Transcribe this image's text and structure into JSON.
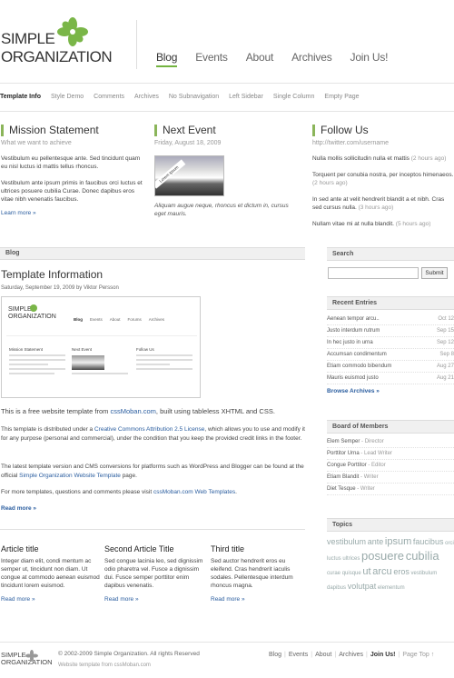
{
  "logo": {
    "line1": "SIMPLE",
    "line2": "ORGANIZATION"
  },
  "main_nav": [
    {
      "label": "Blog",
      "active": true
    },
    {
      "label": "Events",
      "active": false
    },
    {
      "label": "About",
      "active": false
    },
    {
      "label": "Archives",
      "active": false
    },
    {
      "label": "Join Us!",
      "active": false
    }
  ],
  "sub_nav": [
    "Template Info",
    "Style Demo",
    "Comments",
    "Archives",
    "No Subnavigation",
    "Left Sidebar",
    "Single Column",
    "Empty Page"
  ],
  "mission": {
    "title": "Mission Statement",
    "subtitle": "What we want to achieve",
    "p1": "Vestibulum eu pellentesque ante. Sed tincidunt quam eu nisl luctus id mattis tellus rhoncus.",
    "p2": "Vestibulum ante ipsum primis in faucibus orci luctus et ultrices posuere cubilia Curae. Donec dapibus eros vitae nibh venenatis faucibus.",
    "more": "Learn more »"
  },
  "event": {
    "title": "Next Event",
    "date": "Friday, August 18, 2009",
    "image_tag": "Lorem ipsum",
    "caption": "Aliquam augue neque, rhoncus et dictum in, cursus eget mauris."
  },
  "follow": {
    "title": "Follow Us",
    "subtitle": "http://twitter.com/username",
    "tweets": [
      {
        "text": "Nulla mollis sollicitudin nulla et mattis",
        "time": "(2 hours ago)"
      },
      {
        "text": "Torquent per conubia nostra, per inceptos himenaeos.",
        "time": "(2 hours ago)"
      },
      {
        "text": "In sed ante at velit hendrerit blandit a et nibh. Cras sed cursus nulla.",
        "time": "(3 hours ago)"
      },
      {
        "text": "Nullam vitae mi at nulla blandit.",
        "time": "(5 hours ago)"
      }
    ]
  },
  "blog": {
    "bar_label": "Blog",
    "post_title": "Template Information",
    "post_meta": "Saturday, September 19, 2009 by Viktor Persson",
    "shot": {
      "line1": "SIMPLE",
      "line2": "ORGANIZATION",
      "nav": [
        "Blog",
        "Events",
        "About",
        "Forums",
        "Archives"
      ],
      "cols": [
        "Mission Statement",
        "Next Event",
        "Follow Us"
      ]
    },
    "p1_a": "This is a free website template from ",
    "p1_link": "cssMoban.com",
    "p1_b": ", built using tableless XHTML and CSS.",
    "p2_a": "This template is distributed under a ",
    "p2_link": "Creative Commons Attribution 2.5 License",
    "p2_b": ", which allows you to use and modify it for any purpose (personal and commercial), under the condition that you keep the provided credit links in the footer.",
    "p3_a": "The latest template version and CMS conversions for platforms such as WordPress and Blogger can be found at the official ",
    "p3_link": "Simple Organization Website Template",
    "p3_b": " page.",
    "p4_a": "For more templates, questions and comments please visit ",
    "p4_link": "cssMoban.com Web Templates",
    "p4_b": ".",
    "more": "Read more »"
  },
  "articles": [
    {
      "title": "Article title",
      "text": "Integer diam elit, condi mentum ac semper ut, tincidunt non diam. Ut congue at commodo aenean euismod tincidunt lorem euismod.",
      "more": "Read more »"
    },
    {
      "title": "Second Article Title",
      "text": "Sed congue lacinia leo, sed dignissim odio pharetra vel. Fusce a dignissim dui. Fusce semper porttitor enim dapibus venenatis.",
      "more": "Read more »"
    },
    {
      "title": "Third title",
      "text": "Sed auctor hendrerit eros eu eleifend. Cras hendrerit iaculis sodales. Pellentesque interdum rhoncus magna.",
      "more": "Read more »"
    }
  ],
  "sidebar": {
    "search_title": "Search",
    "search_value": "",
    "search_button": "Submit",
    "recent_title": "Recent Entries",
    "recent": [
      {
        "title": "Aenean tempor arcu..",
        "date": "Oct 12"
      },
      {
        "title": "Justo interdum rutrum",
        "date": "Sep 15"
      },
      {
        "title": "In hec justo in urna",
        "date": "Sep 12"
      },
      {
        "title": "Accumsan condimentum",
        "date": "Sep 8"
      },
      {
        "title": "Etiam commodo bibendum",
        "date": "Aug 27"
      },
      {
        "title": "Mauris euismod justo",
        "date": "Aug 21"
      }
    ],
    "browse": "Browse Archives »",
    "board_title": "Board of Members",
    "members": [
      {
        "name": "Elem Semper",
        "role": " - Director"
      },
      {
        "name": "Porttitor Urna",
        "role": " - Lead Writer"
      },
      {
        "name": "Congue Porttitor",
        "role": " - Editor"
      },
      {
        "name": "Etiam Blandit",
        "role": " - Writer"
      },
      {
        "name": "Diet Tesque",
        "role": " - Writer"
      }
    ],
    "topics_title": "Topics",
    "topics": [
      {
        "word": "vestibulum",
        "size": 1
      },
      {
        "word": "ante",
        "size": 1
      },
      {
        "word": "ipsum",
        "size": 2
      },
      {
        "word": "faucibus",
        "size": 1
      },
      {
        "word": "orci",
        "size": 0
      },
      {
        "word": "luctus",
        "size": 0
      },
      {
        "word": "ultrices",
        "size": 0
      },
      {
        "word": "posuere",
        "size": 3
      },
      {
        "word": "cubilia",
        "size": 3
      },
      {
        "word": "curae",
        "size": 0
      },
      {
        "word": "quisque",
        "size": 0
      },
      {
        "word": "ut",
        "size": 2
      },
      {
        "word": "arcu",
        "size": 2
      },
      {
        "word": "eros",
        "size": 1
      },
      {
        "word": "vestibulum",
        "size": 0
      },
      {
        "word": "dapibus",
        "size": 0
      },
      {
        "word": "volutpat",
        "size": 1
      },
      {
        "word": "elementum",
        "size": 4
      }
    ]
  },
  "footer": {
    "logo1": "SIMPLE",
    "logo2": "ORGANIZATION",
    "copyright": "© 2002-2009 Simple Organization. All rights Reserved",
    "template": "Website template from cssMoban.com",
    "nav": [
      "Blog",
      "Events",
      "About",
      "Archives",
      "Join Us!",
      "Page Top ↑"
    ]
  }
}
